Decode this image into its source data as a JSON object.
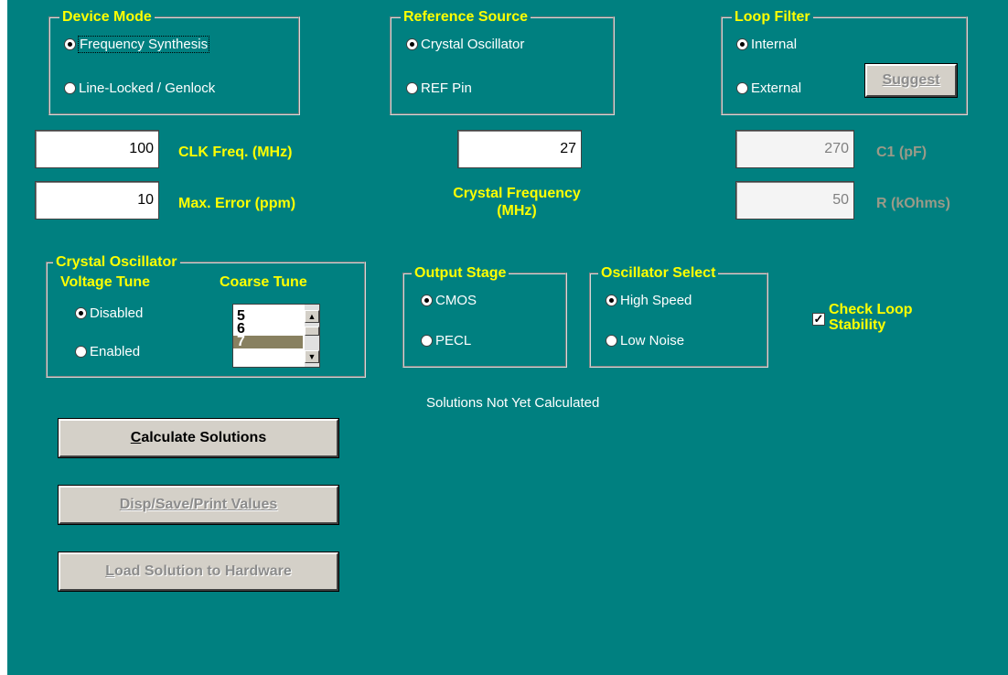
{
  "device_mode": {
    "title": "Device Mode",
    "options": [
      {
        "label": "Frequency Synthesis",
        "selected": true
      },
      {
        "label": "Line-Locked / Genlock",
        "selected": false
      }
    ]
  },
  "reference_source": {
    "title": "Reference Source",
    "options": [
      {
        "label": "Crystal Oscillator",
        "selected": true
      },
      {
        "label": "REF Pin",
        "selected": false
      }
    ]
  },
  "loop_filter": {
    "title": "Loop Filter",
    "options": [
      {
        "label": "Internal",
        "selected": true
      },
      {
        "label": "External",
        "selected": false
      }
    ],
    "suggest_label": "Suggest"
  },
  "clk_freq": {
    "value": "100",
    "label": "CLK Freq. (MHz)"
  },
  "max_error": {
    "value": "10",
    "label": "Max. Error (ppm)"
  },
  "crystal_frequency": {
    "value": "27",
    "label_line1": "Crystal Frequency",
    "label_line2": "(MHz)"
  },
  "c1": {
    "value": "270",
    "label": "C1 (pF)"
  },
  "r": {
    "value": "50",
    "label": "R (kOhms)"
  },
  "crystal_oscillator": {
    "title": "Crystal Oscillator",
    "voltage_tune_label": "Voltage Tune",
    "coarse_tune_label": "Coarse Tune",
    "voltage_options": [
      {
        "label": "Disabled",
        "selected": true
      },
      {
        "label": "Enabled",
        "selected": false
      }
    ],
    "coarse_items": [
      "5",
      "6",
      "7"
    ],
    "coarse_selected": "7"
  },
  "output_stage": {
    "title": "Output Stage",
    "options": [
      {
        "label": "CMOS",
        "selected": true
      },
      {
        "label": "PECL",
        "selected": false
      }
    ]
  },
  "oscillator_select": {
    "title": "Oscillator Select",
    "options": [
      {
        "label": "High Speed",
        "selected": true
      },
      {
        "label": "Low Noise",
        "selected": false
      }
    ]
  },
  "check_loop": {
    "line1": "Check Loop",
    "line2": "Stability",
    "checked": true
  },
  "status_text": "Solutions Not Yet Calculated",
  "buttons": {
    "calculate": {
      "mnemonic": "C",
      "rest": "alculate Solutions"
    },
    "disp": {
      "mnemonic": "D",
      "rest": "isp/Save/Print Values"
    },
    "load": {
      "mnemonic": "L",
      "rest": "oad Solution to Hardware"
    }
  },
  "colors": {
    "background": "#008080",
    "label_yellow": "#ffff00",
    "disabled_gray": "#9a9a88"
  }
}
